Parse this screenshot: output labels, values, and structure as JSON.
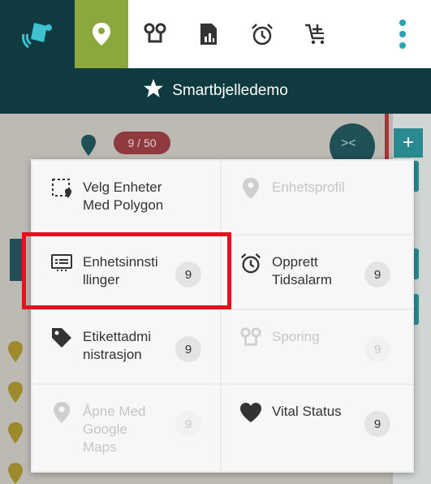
{
  "toolbar": {
    "icons": [
      "bell-logo-icon",
      "location-pin-icon",
      "tracking-icon",
      "report-icon",
      "alarm-clock-icon",
      "cart-add-icon",
      "more-vertical-icon"
    ],
    "accent_active": "#8aa83e",
    "brand_dark": "#0f3b40"
  },
  "header": {
    "title": "Smartbjelledemo",
    "icon": "star-icon"
  },
  "background": {
    "count_badge": "9 / 50",
    "plus_label": "+",
    "collapse_label": "><"
  },
  "menu": {
    "items": [
      {
        "label": "Velg Enheter Med Polygon",
        "icon": "polygon-select-icon",
        "badge": "",
        "enabled": true
      },
      {
        "label": "Enhetsprofil",
        "icon": "location-pin-icon",
        "badge": "",
        "enabled": false
      },
      {
        "label": "Enhetsinnsti llinger",
        "icon": "device-settings-icon",
        "badge": "9",
        "enabled": true,
        "highlighted": true
      },
      {
        "label": "Opprett Tidsalarm",
        "icon": "alarm-clock-icon",
        "badge": "9",
        "enabled": true
      },
      {
        "label": "Etikettadmi nistrasjon",
        "icon": "tag-icon",
        "badge": "9",
        "enabled": true
      },
      {
        "label": "Sporing",
        "icon": "tracking-icon",
        "badge": "9",
        "enabled": false
      },
      {
        "label": "Åpne Med Google Maps",
        "icon": "location-pin-icon",
        "badge": "9",
        "enabled": false
      },
      {
        "label": "Vital Status",
        "icon": "heart-icon",
        "badge": "9",
        "enabled": true
      }
    ]
  },
  "colors": {
    "highlight": "#e3131e"
  }
}
